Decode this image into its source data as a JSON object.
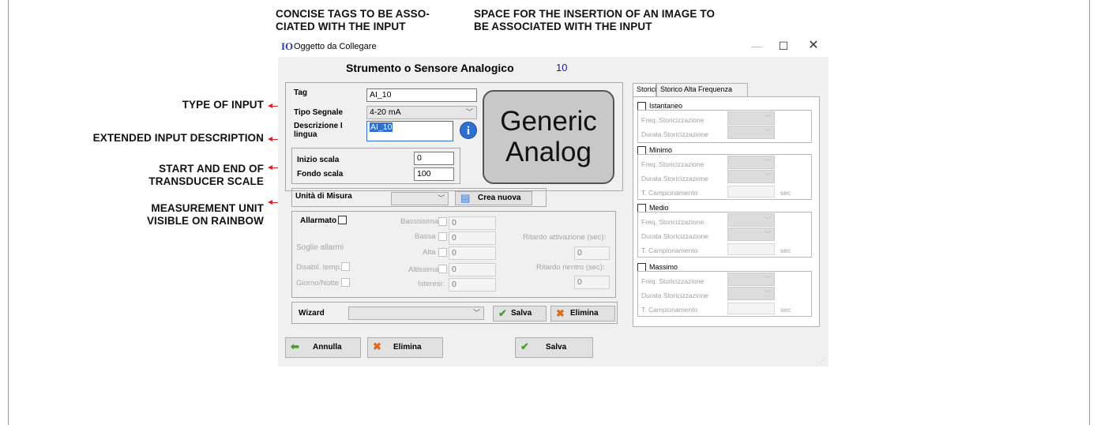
{
  "annotations": {
    "tags_line1": "CONCISE TAGS TO BE ASSO-",
    "tags_line2": "CIATED WITH THE INPUT",
    "image_line1": "SPACE FOR THE INSERTION OF AN IMAGE TO",
    "image_line2": "BE ASSOCIATED WITH THE INPUT",
    "type_of_input": "TYPE OF INPUT",
    "extended_desc": "EXTENDED INPUT DESCRIPTION",
    "scale_line1": "START AND END OF",
    "scale_line2": "TRANSDUCER SCALE",
    "unit_line1": "MEASUREMENT UNIT",
    "unit_line2": "VISIBLE ON RAINBOW",
    "arrow_color": "#e0202a"
  },
  "window": {
    "icon_text": "IO",
    "title": "Oggetto da Collegare",
    "minimize": "—",
    "maximize": "☐",
    "close": "✕"
  },
  "header": {
    "title": "Strumento o Sensore Analogico",
    "number": "10"
  },
  "form": {
    "tag_label": "Tag",
    "tag_value": "AI_10",
    "signal_label": "Tipo Segnale",
    "signal_value": "4-20 mA",
    "desc_label_1": "Descrizione I",
    "desc_label_2": "lingua",
    "desc_value": "AI_10",
    "info_icon": "i",
    "image_text_1": "Generic",
    "image_text_2": "Analog",
    "scale_start_label": "Inizio scala",
    "scale_start_value": "0",
    "scale_end_label": "Fondo scala",
    "scale_end_value": "100",
    "unit_label": "Unità di Misura",
    "unit_value": "",
    "create_new": "Crea nuova"
  },
  "alarms": {
    "alarmed_label": "Allarmato",
    "thresholds_label": "Soglie allarmi",
    "temp_disable_label": "Disabil. temp.",
    "day_night_label": "Giorno/Notte",
    "very_low_label": "Bassissima",
    "very_low_value": "0",
    "low_label": "Bassa",
    "low_value": "0",
    "high_label": "Alta",
    "high_value": "0",
    "very_high_label": "Altissima",
    "very_high_value": "0",
    "hysteresis_label": "Isteresi:",
    "hysteresis_value": "0",
    "activation_delay_label": "Ritardo attivazione (sec):",
    "activation_delay_value": "0",
    "return_delay_label": "Ritardo rientro (sec):",
    "return_delay_value": "0"
  },
  "wizard": {
    "label": "Wizard",
    "value": "",
    "save": "Salva",
    "delete": "Elimina"
  },
  "footer": {
    "cancel": "Annulla",
    "delete": "Elimina",
    "save": "Salva"
  },
  "history": {
    "tabs": [
      "Storici",
      "Storico Alta Frequenza"
    ],
    "instant": {
      "title": "Istantaneo",
      "freq": "Freq. Storicizzazione",
      "duration": "Durata Storicizzazione"
    },
    "minimum": {
      "title": "Minimo",
      "freq": "Freq. Storicizzazione",
      "duration": "Durata Storicizzazione",
      "sampling": "T. Campionamento",
      "unit": "sec"
    },
    "medium": {
      "title": "Medio",
      "freq": "Freq. Storicizzazione",
      "duration": "Durata Storicizzazione",
      "sampling": "T. Campionamento",
      "unit": "sec"
    },
    "maximum": {
      "title": "Massimo",
      "freq": "Freq. Storicizzazione",
      "duration": "Durata Storicizzazione",
      "sampling": "T. Campionamento",
      "unit": "sec"
    }
  }
}
